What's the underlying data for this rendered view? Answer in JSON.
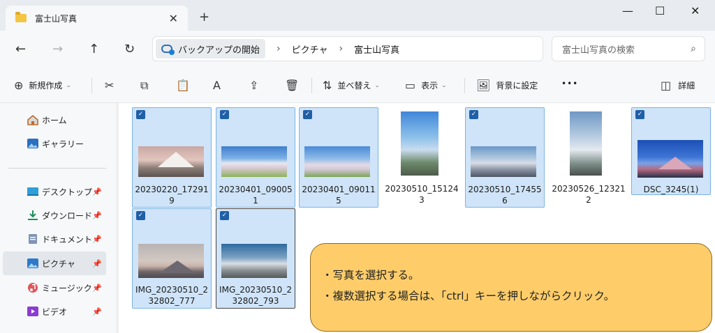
{
  "window": {
    "tab_title": "富士山写真",
    "tab_close": "✕",
    "new_tab": "+",
    "minimize": "—",
    "maximize": "☐",
    "close": "✕"
  },
  "nav": {
    "back": "←",
    "forward": "→",
    "up": "↑",
    "refresh": "↻",
    "breadcrumb": [
      "バックアップの開始",
      "ピクチャ",
      "富士山写真"
    ],
    "separator": "›",
    "search_placeholder": "富士山写真の検索",
    "search_icon": "⌕"
  },
  "toolbar": {
    "new_label": "新規作成",
    "sort_label": "並べ替え",
    "view_label": "表示",
    "background_label": "背景に設定",
    "more": "•••",
    "details_label": "詳細",
    "icons": {
      "new": "⊕",
      "cut": "✂",
      "copy": "⧉",
      "paste": "📋",
      "rename": "A",
      "share": "⇪",
      "delete": "🗑",
      "sort": "⇅",
      "view": "▭",
      "background": "🖼",
      "details": "◫"
    }
  },
  "sidebar": {
    "items": [
      {
        "label": "ホーム",
        "icon": "home-icon",
        "pinned": false
      },
      {
        "label": "ギャラリー",
        "icon": "gallery-icon",
        "pinned": false
      },
      {
        "label": "デスクトップ",
        "icon": "desktop-icon",
        "pinned": true
      },
      {
        "label": "ダウンロード",
        "icon": "download-icon",
        "pinned": true
      },
      {
        "label": "ドキュメント",
        "icon": "document-icon",
        "pinned": true
      },
      {
        "label": "ピクチャ",
        "icon": "pictures-icon",
        "pinned": true,
        "selected": true
      },
      {
        "label": "ミュージック",
        "icon": "music-icon",
        "pinned": true
      },
      {
        "label": "ビデオ",
        "icon": "video-icon",
        "pinned": true
      }
    ],
    "pin_glyph": "📌"
  },
  "files": [
    {
      "name_line1": "20230220_17291",
      "name_line2": "9",
      "selected": true
    },
    {
      "name_line1": "20230401_09005",
      "name_line2": "1",
      "selected": true
    },
    {
      "name_line1": "20230401_09011",
      "name_line2": "5",
      "selected": true
    },
    {
      "name_line1": "20230510_15124",
      "name_line2": "3",
      "selected": false
    },
    {
      "name_line1": "20230510_17455",
      "name_line2": "6",
      "selected": true
    },
    {
      "name_line1": "20230526_12321",
      "name_line2": "2",
      "selected": false
    },
    {
      "name_line1": "DSC_3245(1)",
      "name_line2": "",
      "selected": true
    },
    {
      "name_line1": "IMG_20230510_2",
      "name_line2": "32802_777",
      "selected": true
    },
    {
      "name_line1": "IMG_20230510_2",
      "name_line2": "32802_793",
      "selected": true
    }
  ],
  "check_glyph": "✓",
  "callout": {
    "line1": "・写真を選択する。",
    "line2": "・複数選択する場合は、「ctrl」キーを押しながらクリック。"
  }
}
